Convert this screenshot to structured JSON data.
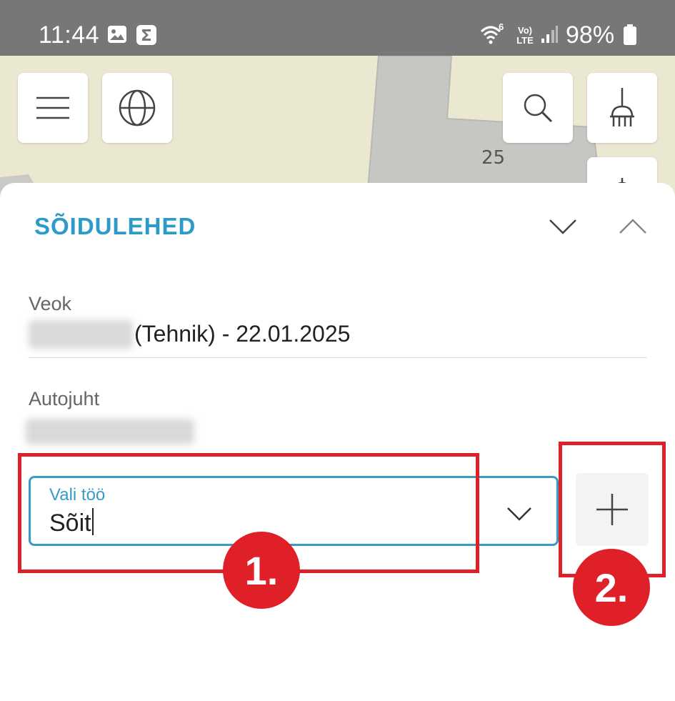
{
  "status_bar": {
    "time": "11:44",
    "battery": "98%",
    "network": "Vo) LTE",
    "wifi_badge": "6"
  },
  "map": {
    "label": "25",
    "icons": [
      "menu-icon",
      "globe-icon",
      "search-icon",
      "broom-icon"
    ]
  },
  "sheet": {
    "title": "SÕIDULEHED",
    "vehicle": {
      "label": "Veok",
      "value": "(Tehnik) - 22.01.2025"
    },
    "driver": {
      "label": "Autojuht"
    },
    "job_select": {
      "label": "Vali töö",
      "value": "Sõit"
    }
  },
  "annotations": {
    "badge_1": "1.",
    "badge_2": "2."
  },
  "colors": {
    "accent": "#2e9ac9",
    "annotation": "#e02028",
    "status_bar": "#777777",
    "map_bg": "#ebe8d2"
  }
}
